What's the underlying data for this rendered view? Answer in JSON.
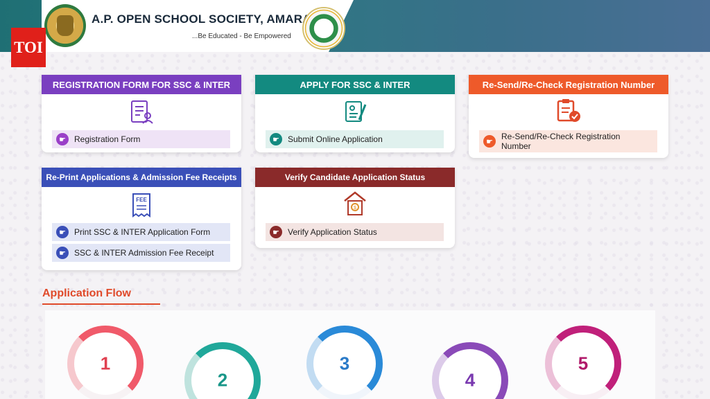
{
  "header": {
    "org_title": "A.P. OPEN SCHOOL SOCIETY, AMARAVATI",
    "tagline": "...Be Educated - Be Empowered",
    "watermark": "TOI"
  },
  "cards": {
    "registration": {
      "title": "REGISTRATION FORM FOR SSC & INTER",
      "color": "#7a3fc0",
      "link": "Registration Form"
    },
    "apply": {
      "title": "APPLY FOR SSC & INTER",
      "color": "#138a80",
      "link": "Submit Online Application"
    },
    "resend": {
      "title": "Re-Send/Re-Check Registration Number",
      "color": "#ee5a2a",
      "link_line1": "Re-Send/Re-Check Registration",
      "link_line2": "Number"
    },
    "reprint": {
      "title": "Re-Print Applications & Admission Fee Receipts",
      "color": "#3a4fb8",
      "link1": "Print SSC & INTER Application Form",
      "link2": "SSC & INTER Admission Fee Receipt",
      "fee_icon_text": "FEE"
    },
    "verify": {
      "title": "Verify Candidate Application Status",
      "color": "#8a2a2a",
      "link": "Verify Application Status"
    }
  },
  "application_flow": {
    "title": "Application Flow",
    "steps": [
      {
        "number": "1",
        "color": "#f05a6a"
      },
      {
        "number": "2",
        "color": "#20a89a"
      },
      {
        "number": "3",
        "color": "#2a8ad8"
      },
      {
        "number": "4",
        "color": "#8a4ab8"
      },
      {
        "number": "5",
        "color": "#c0207a"
      }
    ]
  }
}
